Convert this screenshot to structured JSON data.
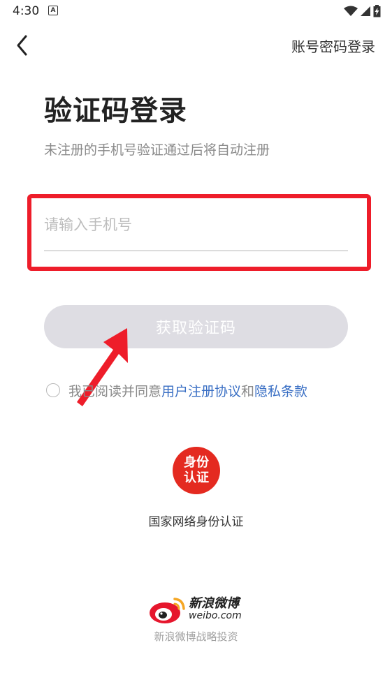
{
  "status_bar": {
    "time": "4:30",
    "notification_letter": "A",
    "icons": [
      "wifi-icon",
      "signal-icon",
      "battery-charging-icon"
    ]
  },
  "header": {
    "back_icon": "chevron-left-icon",
    "account_login_label": "账号密码登录"
  },
  "main": {
    "title": "验证码登录",
    "subtitle": "未注册的手机号验证通过后将自动注册",
    "phone_input": {
      "value": "",
      "placeholder": "请输入手机号"
    },
    "get_code_label": "获取验证码",
    "agreement": {
      "prefix": "我已阅读并同意",
      "user_agreement_link": "用户注册协议",
      "and": "和",
      "privacy_link": "隐私条款",
      "checked": false
    }
  },
  "identity": {
    "badge_line1": "身份",
    "badge_line2": "认证",
    "label": "国家网络身份认证",
    "badge_color": "#e42a20"
  },
  "footer": {
    "brand_cn": "新浪微博",
    "brand_en": "weibo.com",
    "subtitle": "新浪微博战略投资"
  },
  "colors": {
    "highlight": "#ee1d2a",
    "link": "#3a6fc4",
    "button_disabled": "#dedde3"
  }
}
